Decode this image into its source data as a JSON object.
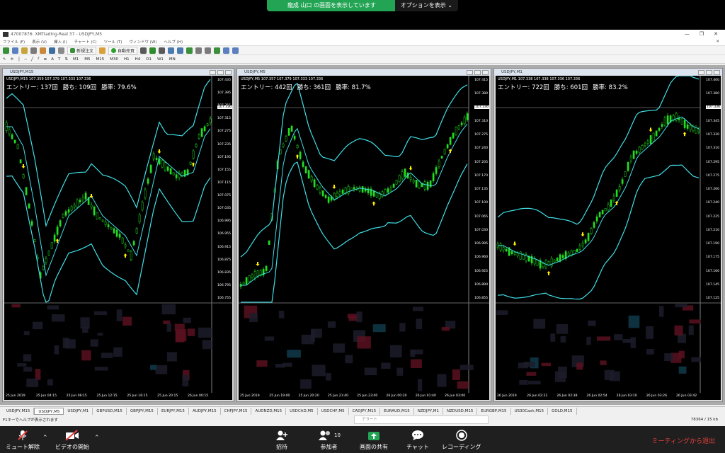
{
  "zoom_banner": {
    "share_text": "龍成 山口 の画面を表示しています",
    "options_label": "オプションを表示"
  },
  "mt4": {
    "title": "47007876: XMTrading-Real 37 - USDJPY,M5",
    "menu": [
      "ファイル (F)",
      "表示 (V)",
      "挿入 (I)",
      "チャート (C)",
      "ツール (T)",
      "ウィンドウ (W)",
      "ヘルプ (H)"
    ],
    "toolbar": {
      "new_order": "新規注文",
      "auto_trade": "自動売買"
    },
    "timeframes": [
      "M1",
      "M5",
      "M15",
      "M30",
      "H1",
      "H4",
      "D1",
      "W1",
      "MN"
    ],
    "status_left": "F1キーでヘルプが表示されます",
    "alert_label": "アラート",
    "status_right": "78364 / 15 kb"
  },
  "charts": [
    {
      "window_title": "USDJPY,M15",
      "symbol_line": "USDJPY,M15  107.359 107.379 107.333 107.336",
      "entries": "エントリー: 137回",
      "wins": "勝ち: 109回",
      "win_rate": "勝率: 79.6%",
      "current_price": "107.336",
      "y_ticks": [
        "107.435",
        "107.395",
        "107.355",
        "107.315",
        "107.275",
        "107.235",
        "107.195",
        "107.155",
        "107.115",
        "107.075",
        "107.035",
        "106.995",
        "106.955",
        "106.915",
        "106.875",
        "106.835",
        "106.795",
        "106.755"
      ],
      "x_ticks": [
        "25 Jun 2019",
        "25 Jun 04:15",
        "25 Jun 08:15",
        "25 Jun 12:15",
        "25 Jun 16:15",
        "25 Jun 20:15",
        "26 Jun 00:15"
      ]
    },
    {
      "window_title": "USDJPY,M5",
      "symbol_line": "USDJPY,M5  107.357 107.379 107.333 107.336",
      "entries": "エントリー: 442回",
      "wins": "勝ち: 361回",
      "win_rate": "勝率: 81.7%",
      "current_price": "107.336",
      "y_ticks": [
        "107.415",
        "107.380",
        "107.345",
        "107.310",
        "107.275",
        "107.240",
        "107.205",
        "107.170",
        "107.135",
        "107.100",
        "107.065",
        "107.030",
        "106.995",
        "106.960",
        "106.925",
        "106.890",
        "106.855"
      ],
      "x_ticks": [
        "25 Jun 2019",
        "25 Jun 19:00",
        "25 Jun 20:20",
        "25 Jun 21:40",
        "25 Jun 23:00",
        "26 Jun 00:20",
        "26 Jun 01:40",
        "26 Jun 03:00"
      ]
    },
    {
      "window_title": "USDJPY,M1",
      "symbol_line": "USDJPY,M1  107.338 107.338 107.336 107.336",
      "entries": "エントリー: 722回",
      "wins": "勝ち: 601回",
      "win_rate": "勝率: 83.2%",
      "current_price": "107.336",
      "y_ticks": [
        "107.400",
        "107.380",
        "107.360",
        "107.345",
        "107.330",
        "107.310",
        "107.295",
        "107.275",
        "107.260",
        "107.240",
        "107.225",
        "107.210",
        "107.190",
        "107.175",
        "107.160",
        "107.145",
        "107.125"
      ],
      "x_ticks": [
        "26 Jun 2019",
        "26 Jun 02:22",
        "26 Jun 02:38",
        "26 Jun 02:54",
        "26 Jun 03:10",
        "26 Jun 03:26",
        "26 Jun 03:42"
      ]
    }
  ],
  "tabs": [
    "USDJPY,M15",
    "USDJPY,M5",
    "USDJPY,M1",
    "GBPUSD,M15",
    "GBPJPY,M15",
    "EURJPY,M15",
    "AUDJPY,M15",
    "CHFJPY,M15",
    "AUDNZD,M15",
    "USDCAD,M5",
    "USDCHF,M5",
    "CADJPY,M15",
    "EURAUD,M15",
    "NZDJPY,M1",
    "NZDUSD,M15",
    "EURGBP,M15",
    "US30Cash,M15",
    "GOLD,M15"
  ],
  "active_tab": 1,
  "zoom_bar": {
    "mute": "ミュート解除",
    "video": "ビデオの開始",
    "invite": "招待",
    "participants": "参加者",
    "participants_count": "10",
    "share": "画面の共有",
    "chat": "チャット",
    "record": "レコーディング",
    "leave": "ミーティングから退出"
  },
  "colors": {
    "bollinger": "#40e0e8",
    "candle": "#22dd22",
    "signal": "#ffee00",
    "zoom_green": "#23a454",
    "leave_red": "#e8413e"
  }
}
